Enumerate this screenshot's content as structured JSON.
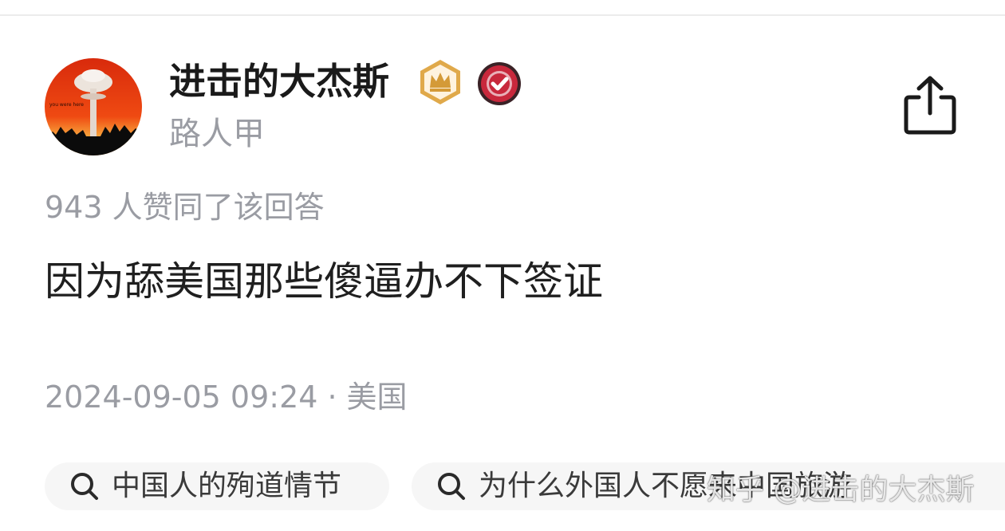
{
  "author": {
    "name": "进击的大杰斯",
    "title": "路人甲",
    "avatar_caption": "you were here",
    "avatar_colors": {
      "sky": "#e8340f",
      "ground": "#0b0b0b",
      "cloud": "#e9e1da"
    },
    "badges": [
      {
        "icon": "crown-badge-icon",
        "color": "#d9a441"
      },
      {
        "icon": "verified-badge-icon",
        "color": "#c8283c"
      }
    ]
  },
  "share": {
    "icon": "share-icon"
  },
  "answer": {
    "vote_text": "943 人赞同了该回答",
    "content": "因为舔美国那些傻逼办不下签证",
    "datetime": "2024-09-05 09:24",
    "separator": "·",
    "location": "美国"
  },
  "related": [
    {
      "icon": "search-icon",
      "label": "中国人的殉道情节"
    },
    {
      "icon": "search-icon",
      "label": "为什么外国人不愿来中国旅游"
    }
  ],
  "watermark": "知乎 @进击的大杰斯"
}
